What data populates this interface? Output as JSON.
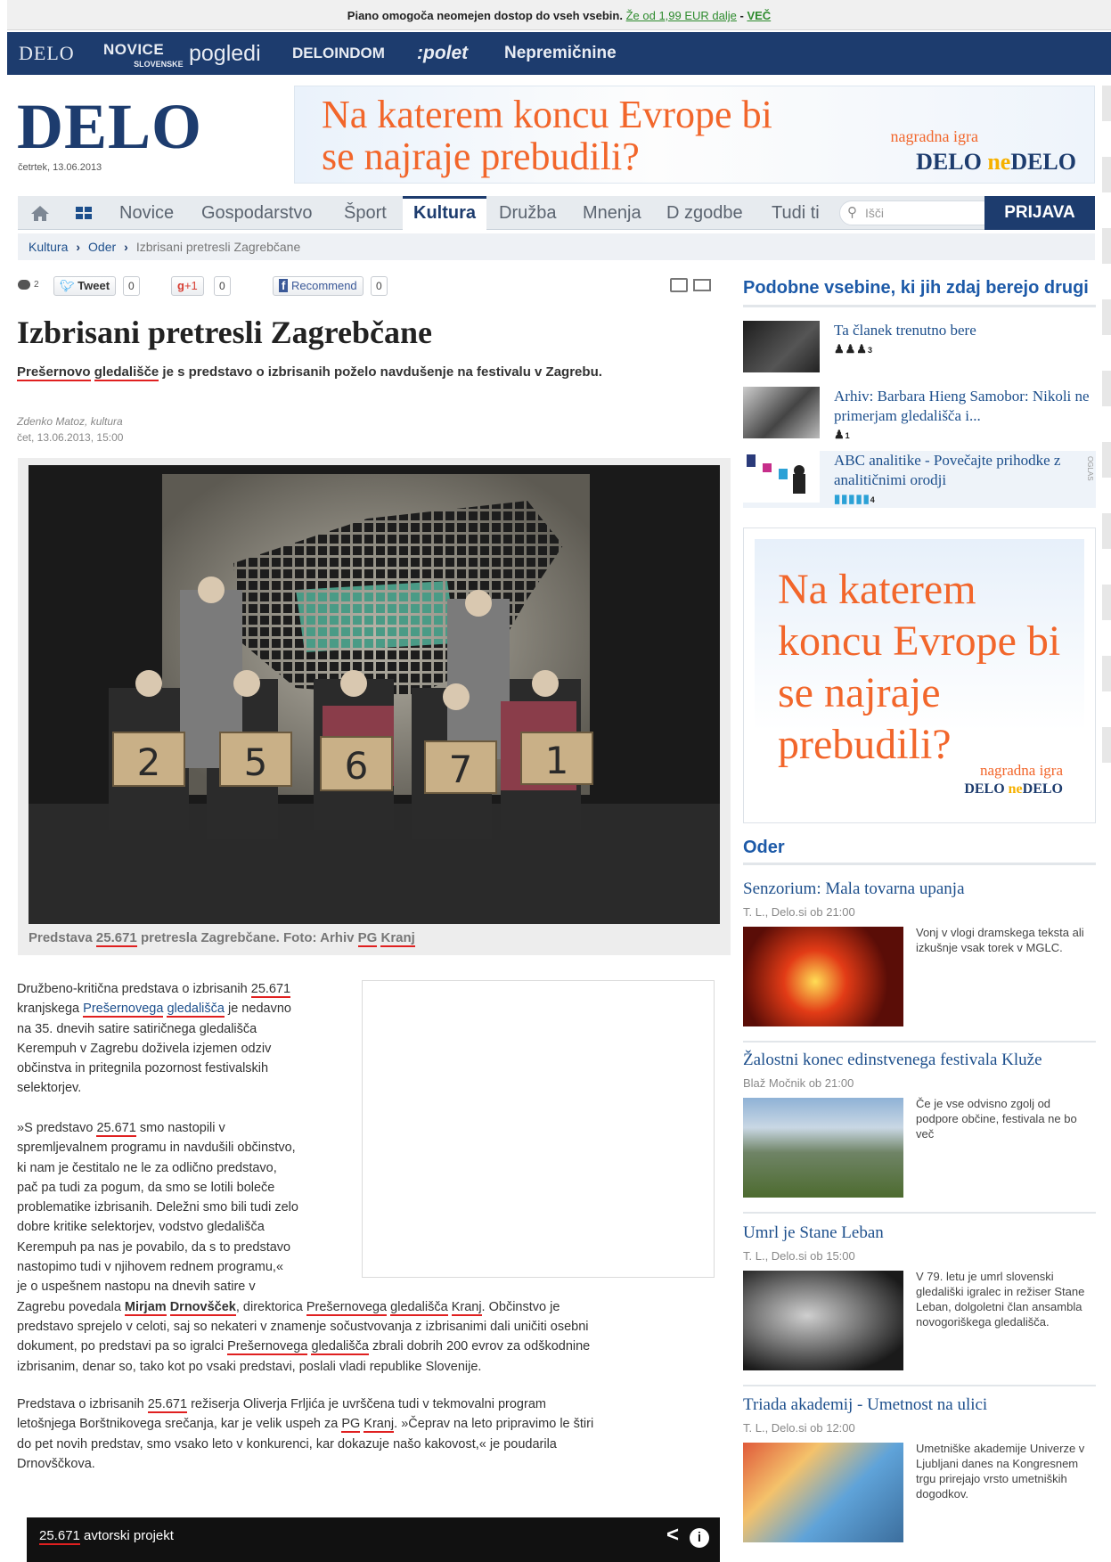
{
  "promo": {
    "text": "Piano omogoča neomejen dostop do vseh vsebin.",
    "link": "Že od 1,99 EUR dalje",
    "sep": " - ",
    "more": "VEČ"
  },
  "netbar": {
    "delo": "DELO",
    "novice_small": "SLOVENSKE",
    "novice": "NOVICE",
    "pogledi": "pogledi",
    "doma": "DELOINDOM",
    "polet": ":polet",
    "nepremicnine": "Nepremičnine"
  },
  "header": {
    "logo": "DELO",
    "date": "četrtek, 13.06.2013"
  },
  "top_ad": {
    "question": "Na katerem koncu Evrope bi se najraje prebudili?",
    "prize": "nagradna igra",
    "brand_a": "DELO ",
    "brand_b": "ne",
    "brand_c": "DELO"
  },
  "nav": {
    "items": [
      "Novice",
      "Gospodarstvo",
      "Šport",
      "Kultura",
      "Družba",
      "Mnenja",
      "D zgodbe",
      "Tudi ti"
    ],
    "search_placeholder": "Išči",
    "login": "PRIJAVA"
  },
  "breadcrumb": {
    "items": [
      "Kultura",
      "Oder"
    ],
    "current": "Izbrisani pretresli Zagrebčane"
  },
  "social": {
    "comments": "2",
    "tweet": "Tweet",
    "tweet_count": "0",
    "gplus": "+1",
    "gplus_count": "0",
    "recommend": "Recommend",
    "recommend_count": "0"
  },
  "article": {
    "title": "Izbrisani pretresli Zagrebčane",
    "lead_u1": "Prešernovo",
    "lead_u2": "gledališče",
    "lead_rest": " je s predstavo o izbrisanih poželo navdušenje na festivalu v Zagrebu.",
    "author": "Zdenko Matoz, kultura",
    "date": "čet, 13.06.2013, 15:00",
    "caption_a": "Predstava ",
    "caption_num": "25.671",
    "caption_b": " pretresla Zagrebčane. Foto: Arhiv ",
    "caption_pg": "PG",
    "caption_sp": " ",
    "caption_kranj": "Kranj",
    "signs": [
      "2",
      "5",
      "6",
      "7",
      "1"
    ],
    "p1": {
      "a": "Družbeno-kritična predstava o izbrisanih ",
      "num": "25.671",
      "b": "kranjskega ",
      "u1": "Prešernovega",
      "u2": "gledališča",
      "c": " je nedavno",
      "d": "na 35. dnevih satire satiričnega gledališča",
      "e": "Kerempuh v Zagrebu doživela izjemen odziv",
      "f": "občinstva in pritegnila pozornost festivalskih",
      "g": "selektorjev."
    },
    "p2": {
      "l1a": "»S predstavo ",
      "l1num": "25.671",
      "l1b": " smo nastopili v",
      "l2": "spremljevalnem programu in navdušili občinstvo,",
      "l3": "ki nam je čestitalo ne le za odlično predstavo,",
      "l4": "pač pa tudi za pogum, da smo se lotili boleče",
      "l5": "problematike izbrisanih. Deležni smo bili tudi zelo",
      "l6": "dobre kritike selektorjev, vodstvo gledališča",
      "l7": "Kerempuh pa nas je povabilo, da s to predstavo",
      "l8": "nastopimo tudi v njihovem rednem programu,«",
      "l9": "je o uspešnem nastopu na dnevih satire v",
      "l10a": "Zagrebu povedala ",
      "l10n1": "Mirjam",
      "l10n2": "Drnovšček",
      "l10b": ", direktorica ",
      "l10u1": "Prešernovega",
      "l10u2": "gledališča",
      "l10u3": "Kranj",
      "l10c": ". Občinstvo je",
      "l11": "predstavo sprejelo v celoti, saj so nekateri v znamenje sočustvovanja z izbrisanimi dali uničiti osebni",
      "l12a": "dokument, po predstavi pa so igralci ",
      "l12u1": "Prešernovega",
      "l12u2": "gledališča",
      "l12b": " zbrali dobrih 200 evrov za odškodnine",
      "l13": "izbrisanim, denar so, tako kot po vsaki predstavi, poslali vladi republike Slovenije."
    },
    "p3": {
      "l1a": "Predstava o izbrisanih ",
      "l1num": "25.671",
      "l1b": " režiserja Oliverja Frljića je uvrščena tudi v tekmovalni  program",
      "l2a": "letošnjega Borštnikovega srečanja, kar je velik uspeh za ",
      "l2pg": "PG",
      "l2sp": " ",
      "l2kr": "Kranj",
      "l2b": ". »Čeprav na leto pripravimo le štiri",
      "l3": "do pet novih predstav, smo vsako leto v konkurenci, kar dokazuje našo kakovost,« je poudarila",
      "l4": "Drnovščkova."
    },
    "video_num": "25.671",
    "video_title": " avtorski projekt"
  },
  "sidebar": {
    "related_title": "Podobne vsebine, ki jih zdaj berejo drugi",
    "related": [
      {
        "title": "Ta članek trenutno bere",
        "count": "3"
      },
      {
        "title": "Arhiv: Barbara Hieng Samobor: Nikoli ne primerjam gledališča i...",
        "count": "1"
      },
      {
        "title": "ABC analitike - Povečajte prihodke z analitičnimi orodji",
        "count": "4"
      }
    ],
    "oglas": "OGLAS",
    "ad": {
      "question": "Na katerem koncu Evrope bi se najraje prebudili?",
      "prize": "nagradna igra",
      "brand_a": "DELO ",
      "brand_b": "ne",
      "brand_c": "DELO"
    },
    "oder_title": "Oder",
    "oder": [
      {
        "title": "Senzorium: Mala tovarna upanja",
        "meta": "T. L., Delo.si  ob 21:00",
        "text": "Vonj v vlogi dramskega teksta ali izkušnje vsak torek v MGLC."
      },
      {
        "title": "Žalostni konec edinstvenega festivala Kluže",
        "meta": "Blaž Močnik  ob 21:00",
        "text": "Če je vse odvisno zgolj od podpore občine, festivala ne bo več"
      },
      {
        "title": "Umrl je Stane Leban",
        "meta": "T. L., Delo.si  ob 15:00",
        "text": "V 79. letu je umrl slovenski gledališki igralec in režiser Stane Leban, dolgoletni član ansambla novogoriškega gledališča."
      },
      {
        "title": "Triada akademij - Umetnost na ulici",
        "meta": "T. L., Delo.si  ob 12:00",
        "text": "Umetniške akademije Univerze v Ljubljani danes na Kongresnem trgu prirejajo vrsto umetniških dogodkov."
      }
    ]
  }
}
